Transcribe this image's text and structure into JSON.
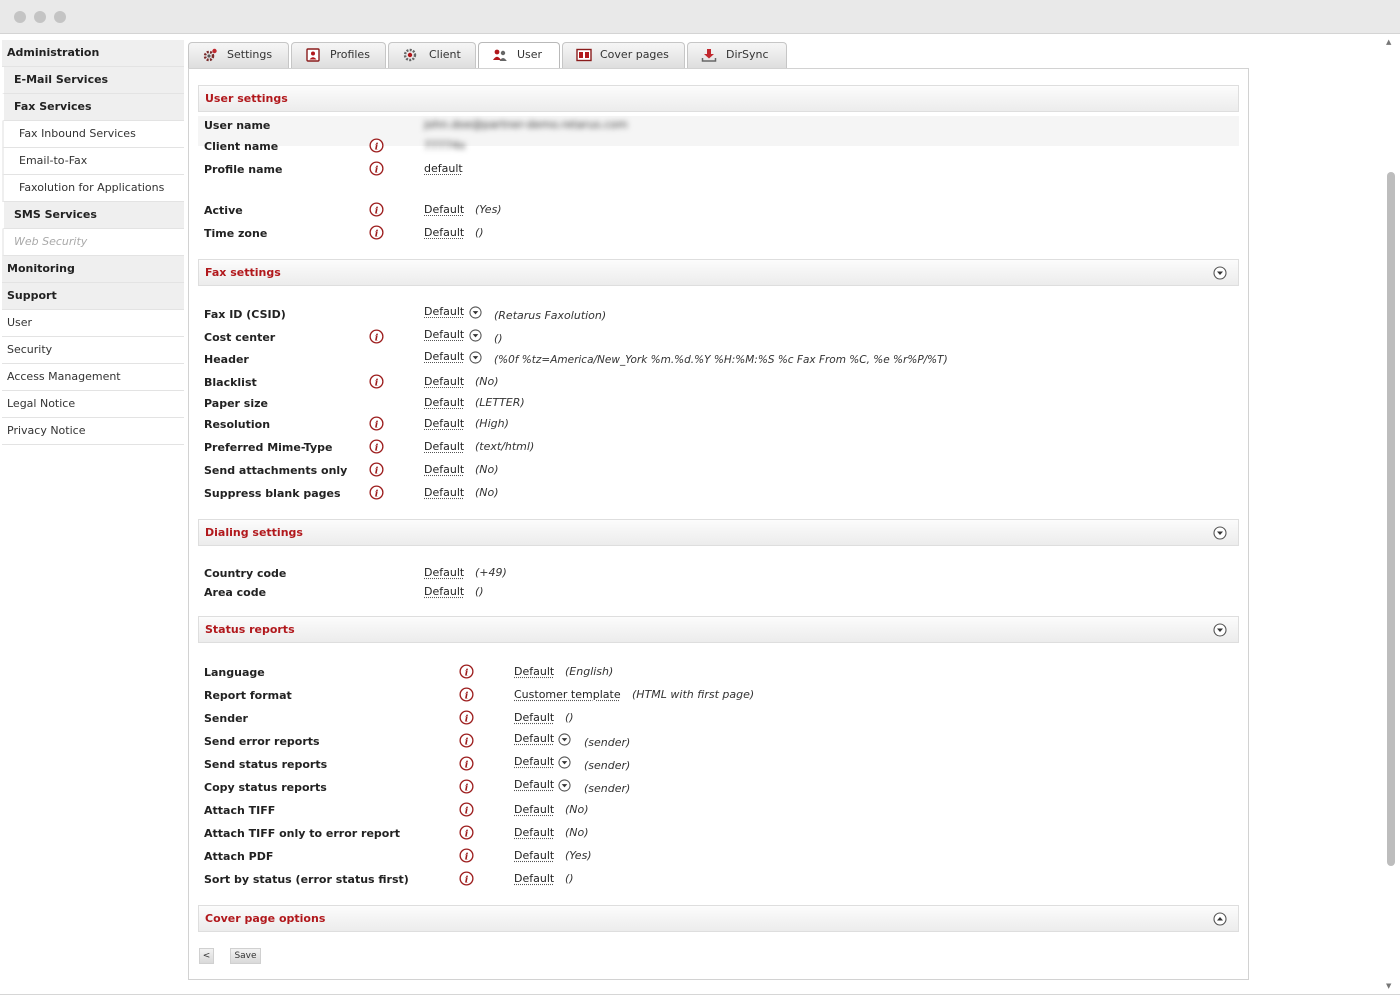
{
  "sidebar": {
    "items": [
      {
        "label": "Administration",
        "level": "l0"
      },
      {
        "label": "E-Mail Services",
        "level": "l1"
      },
      {
        "label": "Fax Services",
        "level": "l1"
      },
      {
        "label": "Fax Inbound Services",
        "level": "l2"
      },
      {
        "label": "Email-to-Fax",
        "level": "l2"
      },
      {
        "label": "Faxolution for Applications",
        "level": "l2"
      },
      {
        "label": "SMS Services",
        "level": "l1"
      },
      {
        "label": "Web Security",
        "level": "l1p"
      },
      {
        "label": "Monitoring",
        "level": "l0"
      },
      {
        "label": "Support",
        "level": "l0"
      },
      {
        "label": "User",
        "level": "lp"
      },
      {
        "label": "Security",
        "level": "lp"
      },
      {
        "label": "Access Management",
        "level": "lp"
      },
      {
        "label": "Legal Notice",
        "level": "lp"
      },
      {
        "label": "Privacy Notice",
        "level": "lp"
      }
    ]
  },
  "tabs": [
    {
      "label": "Settings",
      "icon": "gear-icon",
      "active": false
    },
    {
      "label": "Profiles",
      "icon": "profile-icon",
      "active": false
    },
    {
      "label": "Client",
      "icon": "client-icon",
      "active": false
    },
    {
      "label": "User",
      "icon": "users-icon",
      "active": true
    },
    {
      "label": "Cover pages",
      "icon": "cover-pages-icon",
      "active": false
    },
    {
      "label": "DirSync",
      "icon": "download-icon",
      "active": false
    }
  ],
  "colors": {
    "accent": "#b1181c",
    "tab_bg": "#e6e6e6",
    "section_bg": "#efefef"
  },
  "user_settings": {
    "title": "User settings",
    "rows": [
      {
        "label": "User name",
        "value": "john.doe@partner-demo.retarus.com"
      },
      {
        "label": "Client name",
        "value": "77774x"
      },
      {
        "label": "Profile name",
        "value": "default"
      },
      {
        "label": "Active",
        "value": "Default",
        "effective": "(Yes)"
      },
      {
        "label": "Time zone",
        "value": "Default",
        "effective": "()"
      }
    ]
  },
  "fax_settings": {
    "title": "Fax settings",
    "rows": [
      {
        "label": "Fax ID (CSID)",
        "value": "Default",
        "effective": "(Retarus Faxolution)"
      },
      {
        "label": "Cost center",
        "value": "Default",
        "effective": "()"
      },
      {
        "label": "Header",
        "value": "Default",
        "effective": "(%0f %tz=America/New_York %m.%d.%Y %H:%M:%S %c Fax From %C, %e %r%P/%T)"
      },
      {
        "label": "Blacklist",
        "value": "Default",
        "effective": "(No)"
      },
      {
        "label": "Paper size",
        "value": "Default",
        "effective": "(LETTER)"
      },
      {
        "label": "Resolution",
        "value": "Default",
        "effective": "(High)"
      },
      {
        "label": "Preferred Mime-Type",
        "value": "Default",
        "effective": "(text/html)"
      },
      {
        "label": "Send attachments only",
        "value": "Default",
        "effective": "(No)"
      },
      {
        "label": "Suppress blank pages",
        "value": "Default",
        "effective": "(No)"
      }
    ]
  },
  "dialing_settings": {
    "title": "Dialing settings",
    "rows": [
      {
        "label": "Country code",
        "value": "Default",
        "effective": "(+49)"
      },
      {
        "label": "Area code",
        "value": "Default",
        "effective": "()"
      }
    ]
  },
  "status_reports": {
    "title": "Status reports",
    "rows": [
      {
        "label": "Language",
        "value": "Default",
        "effective": "(English)"
      },
      {
        "label": "Report format",
        "value": "Customer template",
        "effective": "(HTML with first page)"
      },
      {
        "label": "Sender",
        "value": "Default",
        "effective": "()"
      },
      {
        "label": "Send error reports",
        "value": "Default",
        "effective": "(sender)"
      },
      {
        "label": "Send status reports",
        "value": "Default",
        "effective": "(sender)"
      },
      {
        "label": "Copy status reports",
        "value": "Default",
        "effective": "(sender)"
      },
      {
        "label": "Attach TIFF",
        "value": "Default",
        "effective": "(No)"
      },
      {
        "label": "Attach TIFF only to error report",
        "value": "Default",
        "effective": "(No)"
      },
      {
        "label": "Attach PDF",
        "value": "Default",
        "effective": "(Yes)"
      },
      {
        "label": "Sort by status (error status first)",
        "value": "Default",
        "effective": "()"
      }
    ]
  },
  "cover_page_options": {
    "title": "Cover page options"
  },
  "buttons": {
    "back": "<",
    "save": "Save"
  }
}
